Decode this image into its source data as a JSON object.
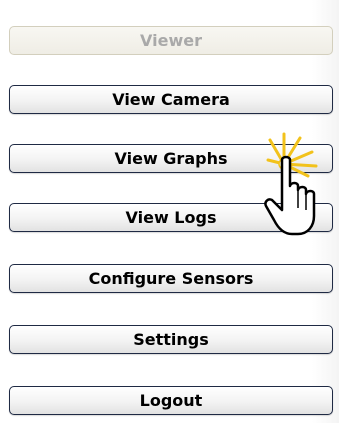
{
  "menu": {
    "header_label": "Viewer",
    "items": [
      {
        "label": "View Camera"
      },
      {
        "label": "View Graphs"
      },
      {
        "label": "View Logs"
      },
      {
        "label": "Configure Sensors"
      },
      {
        "label": "Settings"
      },
      {
        "label": "Logout"
      }
    ]
  },
  "cursor": {
    "icon": "hand-pointer-icon",
    "effect": "click-burst-icon"
  },
  "colors": {
    "button_border": "#1f2a44",
    "disabled_text": "#a9a9a9",
    "click_burst": "#f2c21b"
  }
}
